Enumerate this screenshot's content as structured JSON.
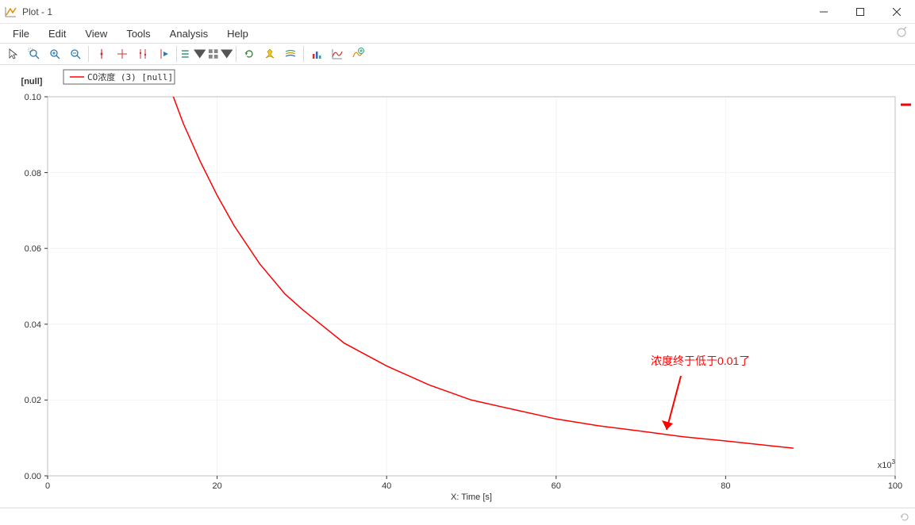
{
  "window": {
    "title": "Plot - 1"
  },
  "menu": {
    "file": "File",
    "edit": "Edit",
    "view": "View",
    "tools": "Tools",
    "analysis": "Analysis",
    "help": "Help"
  },
  "toolbar_icons": [
    "cursor",
    "zoom-area",
    "zoom-in",
    "zoom-out",
    "sep",
    "marker-single",
    "marker-cross",
    "marker-multi",
    "marker-play",
    "sep",
    "list-options",
    "grid-options",
    "sep",
    "refresh",
    "pin",
    "layers",
    "sep",
    "bar-chart",
    "curve-chart",
    "add-chart"
  ],
  "plot": {
    "y_unit_label": "[null]",
    "x_label": "X: Time [s]",
    "x_exponent": "x10",
    "x_exponent_sup": "3",
    "x_ticks": [
      "0",
      "20",
      "40",
      "60",
      "80",
      "100"
    ],
    "y_ticks": [
      "0.00",
      "0.02",
      "0.04",
      "0.06",
      "0.08",
      "0.10"
    ],
    "legend": {
      "series1": "CO浓度 (3) [null]"
    },
    "annotation": {
      "text": "浓度终于低于0.01了"
    }
  },
  "chart_data": {
    "type": "line",
    "title": "",
    "xlabel": "X: Time [s]",
    "ylabel": "[null]",
    "xlim": [
      0,
      100000
    ],
    "ylim": [
      0,
      0.1
    ],
    "x_tick_values": [
      0,
      20000,
      40000,
      60000,
      80000,
      100000
    ],
    "y_tick_values": [
      0.0,
      0.02,
      0.04,
      0.06,
      0.08,
      0.1
    ],
    "series": [
      {
        "name": "CO浓度 (3) [null]",
        "color": "#ff0000",
        "x": [
          12000,
          14000,
          16000,
          18000,
          20000,
          22000,
          25000,
          28000,
          30000,
          35000,
          40000,
          45000,
          50000,
          55000,
          60000,
          65000,
          70000,
          75000,
          80000,
          85000,
          88000
        ],
        "y": [
          0.12,
          0.105,
          0.093,
          0.083,
          0.074,
          0.066,
          0.056,
          0.048,
          0.044,
          0.035,
          0.029,
          0.024,
          0.02,
          0.0175,
          0.015,
          0.0132,
          0.0118,
          0.0103,
          0.0092,
          0.008,
          0.0073
        ]
      }
    ],
    "annotations": [
      {
        "text": "浓度终于低于0.01了",
        "x": 86000,
        "y": 0.028,
        "arrow_to_x": 76000,
        "arrow_to_y": 0.0105
      }
    ]
  }
}
